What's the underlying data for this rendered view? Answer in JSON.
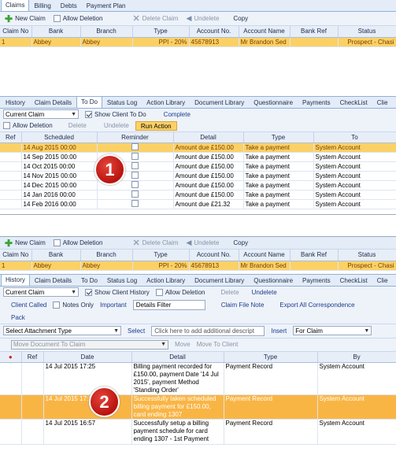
{
  "top_tabs": [
    "Claims",
    "Billing",
    "Debts",
    "Payment Plan"
  ],
  "toolbar": {
    "new_claim": "New Claim",
    "allow_deletion": "Allow Deletion",
    "delete_claim": "Delete Claim",
    "undelete": "Undelete",
    "copy": "Copy"
  },
  "claims_headers": [
    "Claim No",
    "Bank",
    "Branch",
    "Type",
    "Account No.",
    "Account Name",
    "Bank Ref",
    "Status"
  ],
  "claims_row": [
    "1",
    "Abbey",
    "Abbey",
    "PPI - 20%",
    "45678913",
    "Mr Brandon Sed",
    "",
    "Prospect - Chasi"
  ],
  "mid_tabs": [
    "History",
    "Claim Details",
    "To Do",
    "Status Log",
    "Action Library",
    "Document Library",
    "Questionnaire",
    "Payments",
    "CheckList",
    "Clie"
  ],
  "todo": {
    "filter": "Current Claim",
    "show_client": "Show Client To Do",
    "complete": "Complete",
    "allow_deletion": "Allow Deletion",
    "delete": "Delete",
    "undelete": "Undelete",
    "run_action": "Run Action"
  },
  "todo_headers": [
    "Ref",
    "Scheduled",
    "Reminder",
    "Detail",
    "Type",
    "To"
  ],
  "todo_rows": [
    [
      "14 Aug 2015 00:00",
      "Amount due £150.00",
      "Take a payment",
      "System Account"
    ],
    [
      "14 Sep 2015 00:00",
      "Amount due £150.00",
      "Take a payment",
      "System Account"
    ],
    [
      "14 Oct 2015 00:00",
      "Amount due £150.00",
      "Take a payment",
      "System Account"
    ],
    [
      "14 Nov 2015 00:00",
      "Amount due £150.00",
      "Take a payment",
      "System Account"
    ],
    [
      "14 Dec 2015 00:00",
      "Amount due £150.00",
      "Take a payment",
      "System Account"
    ],
    [
      "14 Jan 2016 00:00",
      "Amount due £150.00",
      "Take a payment",
      "System Account"
    ],
    [
      "14 Feb 2016 00:00",
      "Amount due £21.32",
      "Take a payment",
      "System Account"
    ]
  ],
  "marker1": "1",
  "marker2": "2",
  "history": {
    "filter": "Current Claim",
    "show_history": "Show Client History",
    "allow_deletion": "Allow Deletion",
    "delete": "Delete",
    "undelete": "Undelete",
    "client_called": "Client Called",
    "notes_only": "Notes Only",
    "important": "Important",
    "details_filter": "Details Filter",
    "file_note": "Claim File Note",
    "export": "Export All Correspondence",
    "pack": "Pack",
    "attachment_type": "Select Attachment Type",
    "select": "Select",
    "add_desc": "Click here to add additional descript",
    "insert": "Insert",
    "for_claim": "For Claim",
    "move_doc": "Move Document To Claim",
    "move": "Move",
    "move_client": "Move To Client"
  },
  "history_headers": [
    "Ref",
    "Date",
    "Detail",
    "Type",
    "By"
  ],
  "history_rows": [
    [
      "14 Jul 2015 17:25",
      "Billing payment recorded for £150.00, payment Date '14 Jul 2015', payment Method 'Standing Order'",
      "Payment Record",
      "System Account"
    ],
    [
      "14 Jul 2015 17:18",
      "Successfully taken scheduled billing payment for £150.00, card ending 1307",
      "Payment Record",
      "System Account"
    ],
    [
      "14 Jul 2015 16:57",
      "Successfully setup a billing payment schedule for card ending 1307 - 1st Payment",
      "Payment Record",
      "System Account"
    ]
  ]
}
